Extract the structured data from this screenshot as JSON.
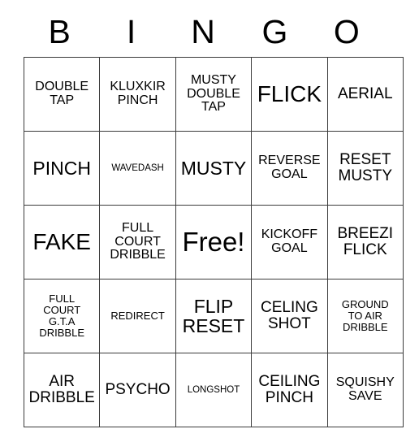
{
  "card": {
    "header_letters": [
      "B",
      "I",
      "N",
      "G",
      "O"
    ],
    "rows": [
      [
        {
          "text": "DOUBLE\nTAP",
          "size": "fs-s"
        },
        {
          "text": "KLUXKIR\nPINCH",
          "size": "fs-s"
        },
        {
          "text": "MUSTY\nDOUBLE\nTAP",
          "size": "fs-s"
        },
        {
          "text": "FLICK",
          "size": "fs-xl"
        },
        {
          "text": "AERIAL",
          "size": "fs-m"
        }
      ],
      [
        {
          "text": "PINCH",
          "size": "fs-l"
        },
        {
          "text": "WAVEDASH",
          "size": "fs-xxs"
        },
        {
          "text": "MUSTY",
          "size": "fs-l"
        },
        {
          "text": "REVERSE\nGOAL",
          "size": "fs-s"
        },
        {
          "text": "RESET\nMUSTY",
          "size": "fs-m"
        }
      ],
      [
        {
          "text": "FAKE",
          "size": "fs-xl"
        },
        {
          "text": "FULL\nCOURT\nDRIBBLE",
          "size": "fs-s"
        },
        {
          "text": "Free!",
          "size": "fs-xxl"
        },
        {
          "text": "KICKOFF\nGOAL",
          "size": "fs-s"
        },
        {
          "text": "BREEZI\nFLICK",
          "size": "fs-m"
        }
      ],
      [
        {
          "text": "FULL\nCOURT\nG.T.A\nDRIBBLE",
          "size": "fs-xs"
        },
        {
          "text": "REDIRECT",
          "size": "fs-xs"
        },
        {
          "text": "FLIP\nRESET",
          "size": "fs-l"
        },
        {
          "text": "CELING\nSHOT",
          "size": "fs-m"
        },
        {
          "text": "GROUND\nTO AIR\nDRIBBLE",
          "size": "fs-xs"
        }
      ],
      [
        {
          "text": "AIR\nDRIBBLE",
          "size": "fs-m"
        },
        {
          "text": "PSYCHO",
          "size": "fs-m"
        },
        {
          "text": "LONGSHOT",
          "size": "fs-xxs"
        },
        {
          "text": "CEILING\nPINCH",
          "size": "fs-m"
        },
        {
          "text": "SQUISHY\nSAVE",
          "size": "fs-s"
        }
      ]
    ]
  },
  "colors": {
    "background": "#ffffff",
    "text": "#000000",
    "border": "#3b3b3b"
  }
}
